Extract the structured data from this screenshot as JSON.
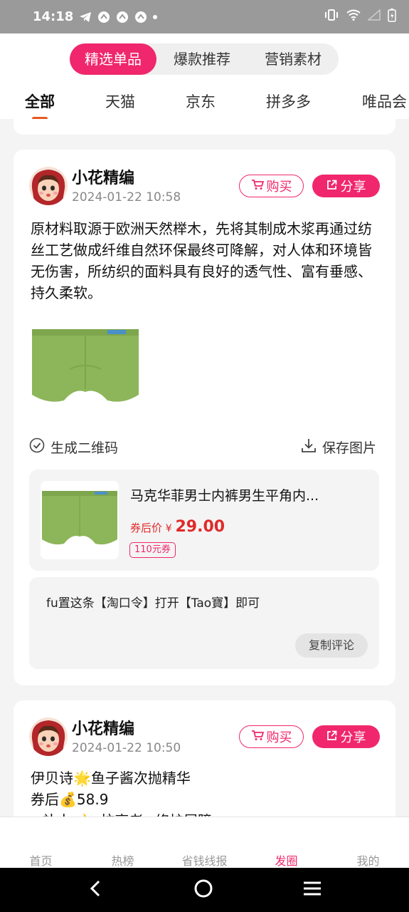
{
  "status_bar": {
    "time": "14:18",
    "icons": [
      "telegram-icon",
      "app-icon",
      "app-icon",
      "app-icon",
      "dot-icon",
      "vibrate-icon",
      "wifi-icon",
      "signal-icon",
      "battery-charging-icon"
    ]
  },
  "header": {
    "segments": [
      {
        "label": "精选单品",
        "active": true
      },
      {
        "label": "爆款推荐",
        "active": false
      },
      {
        "label": "营销素材",
        "active": false
      }
    ],
    "tabs": [
      {
        "label": "全部",
        "active": true
      },
      {
        "label": "天猫",
        "active": false
      },
      {
        "label": "京东",
        "active": false
      },
      {
        "label": "拼多多",
        "active": false
      },
      {
        "label": "唯品会",
        "active": false
      }
    ]
  },
  "posts": [
    {
      "author": "小花精编",
      "date": "2024-01-22 10:58",
      "buy_label": "购买",
      "share_label": "分享",
      "content": "原材料取源于欧洲天然榉木，先将其制成木浆再通过纺丝工艺做成纤维自然环保最终可降解，对人体和环境皆无伤害，所纺织的面料具有良好的透气性、富有垂感、持久柔软。",
      "qr_label": "生成二维码",
      "save_label": "保存图片",
      "goods": {
        "title": "马克华菲男士内裤男生平角内...",
        "price_label": "券后价",
        "currency": "¥",
        "price": "29.00",
        "coupon": "110元券"
      },
      "comment": {
        "text": "fu置这条【淘口令】打开【Tao寶】即可",
        "copy_label": "复制评论"
      }
    },
    {
      "author": "小花精编",
      "date": "2024-01-22 10:50",
      "buy_label": "购买",
      "share_label": "分享",
      "content_lines": [
        "伊贝诗🌟鱼子酱次抛精华",
        "券后💰58.9",
        "✓补水🌙✓抗衰老✓修护屏障"
      ]
    }
  ],
  "bottom_nav": [
    {
      "label": "首页",
      "active": false
    },
    {
      "label": "热榜",
      "active": false
    },
    {
      "label": "省钱线报",
      "active": false
    },
    {
      "label": "发圈",
      "active": true
    },
    {
      "label": "我的",
      "active": false
    }
  ],
  "colors": {
    "accent": "#f0276c",
    "price_red": "#e02a2a",
    "tab_indicator": "#e9581f",
    "product_green": "#8db55a"
  }
}
